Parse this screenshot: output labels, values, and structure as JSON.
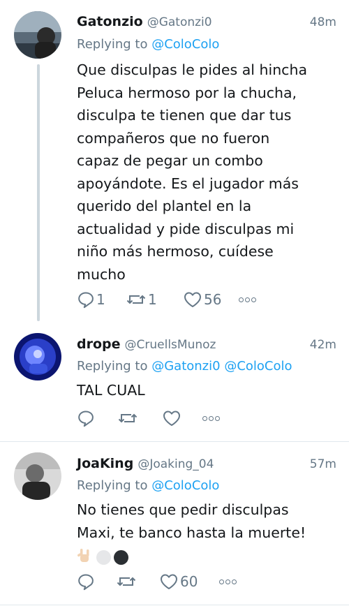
{
  "tweets": [
    {
      "name": "Gatonzio",
      "handle": "@Gatonzi0",
      "time": "48m",
      "replying_prefix": "Replying to",
      "mentions": [
        "@ColoColo"
      ],
      "text_lines": [
        "Que disculpas le pides al hincha",
        "Peluca hermoso por la chucha,",
        "disculpa te tienen que dar tus",
        "compañeros que no fueron",
        "capaz de pegar un combo",
        "apoyándote. Es el jugador más",
        "querido del plantel en la",
        "actualidad y pide disculpas mi",
        "niño más hermoso, cuídese",
        "mucho"
      ],
      "replies": "1",
      "retweets": "1",
      "likes": "56"
    },
    {
      "name": "drope",
      "handle": "@CruellsMunoz",
      "time": "42m",
      "replying_prefix": "Replying to",
      "mentions": [
        "@Gatonzi0",
        "@ColoColo"
      ],
      "text_lines": [
        "TAL CUAL"
      ]
    },
    {
      "name": "JoaKing",
      "handle": "@Joaking_04",
      "time": "57m",
      "replying_prefix": "Replying to",
      "mentions": [
        "@ColoColo"
      ],
      "text_lines": [
        "No tienes que pedir disculpas",
        "Maxi, te banco hasta la muerte!"
      ],
      "emoji": [
        "rock-hand-emoji",
        "white-circle-emoji",
        "black-circle-emoji"
      ],
      "likes": "60"
    }
  ],
  "colors": {
    "link": "#1da1f2",
    "secondary_text": "#657786",
    "thread_line": "#ccd6dd",
    "divider": "#e1e8ed"
  }
}
